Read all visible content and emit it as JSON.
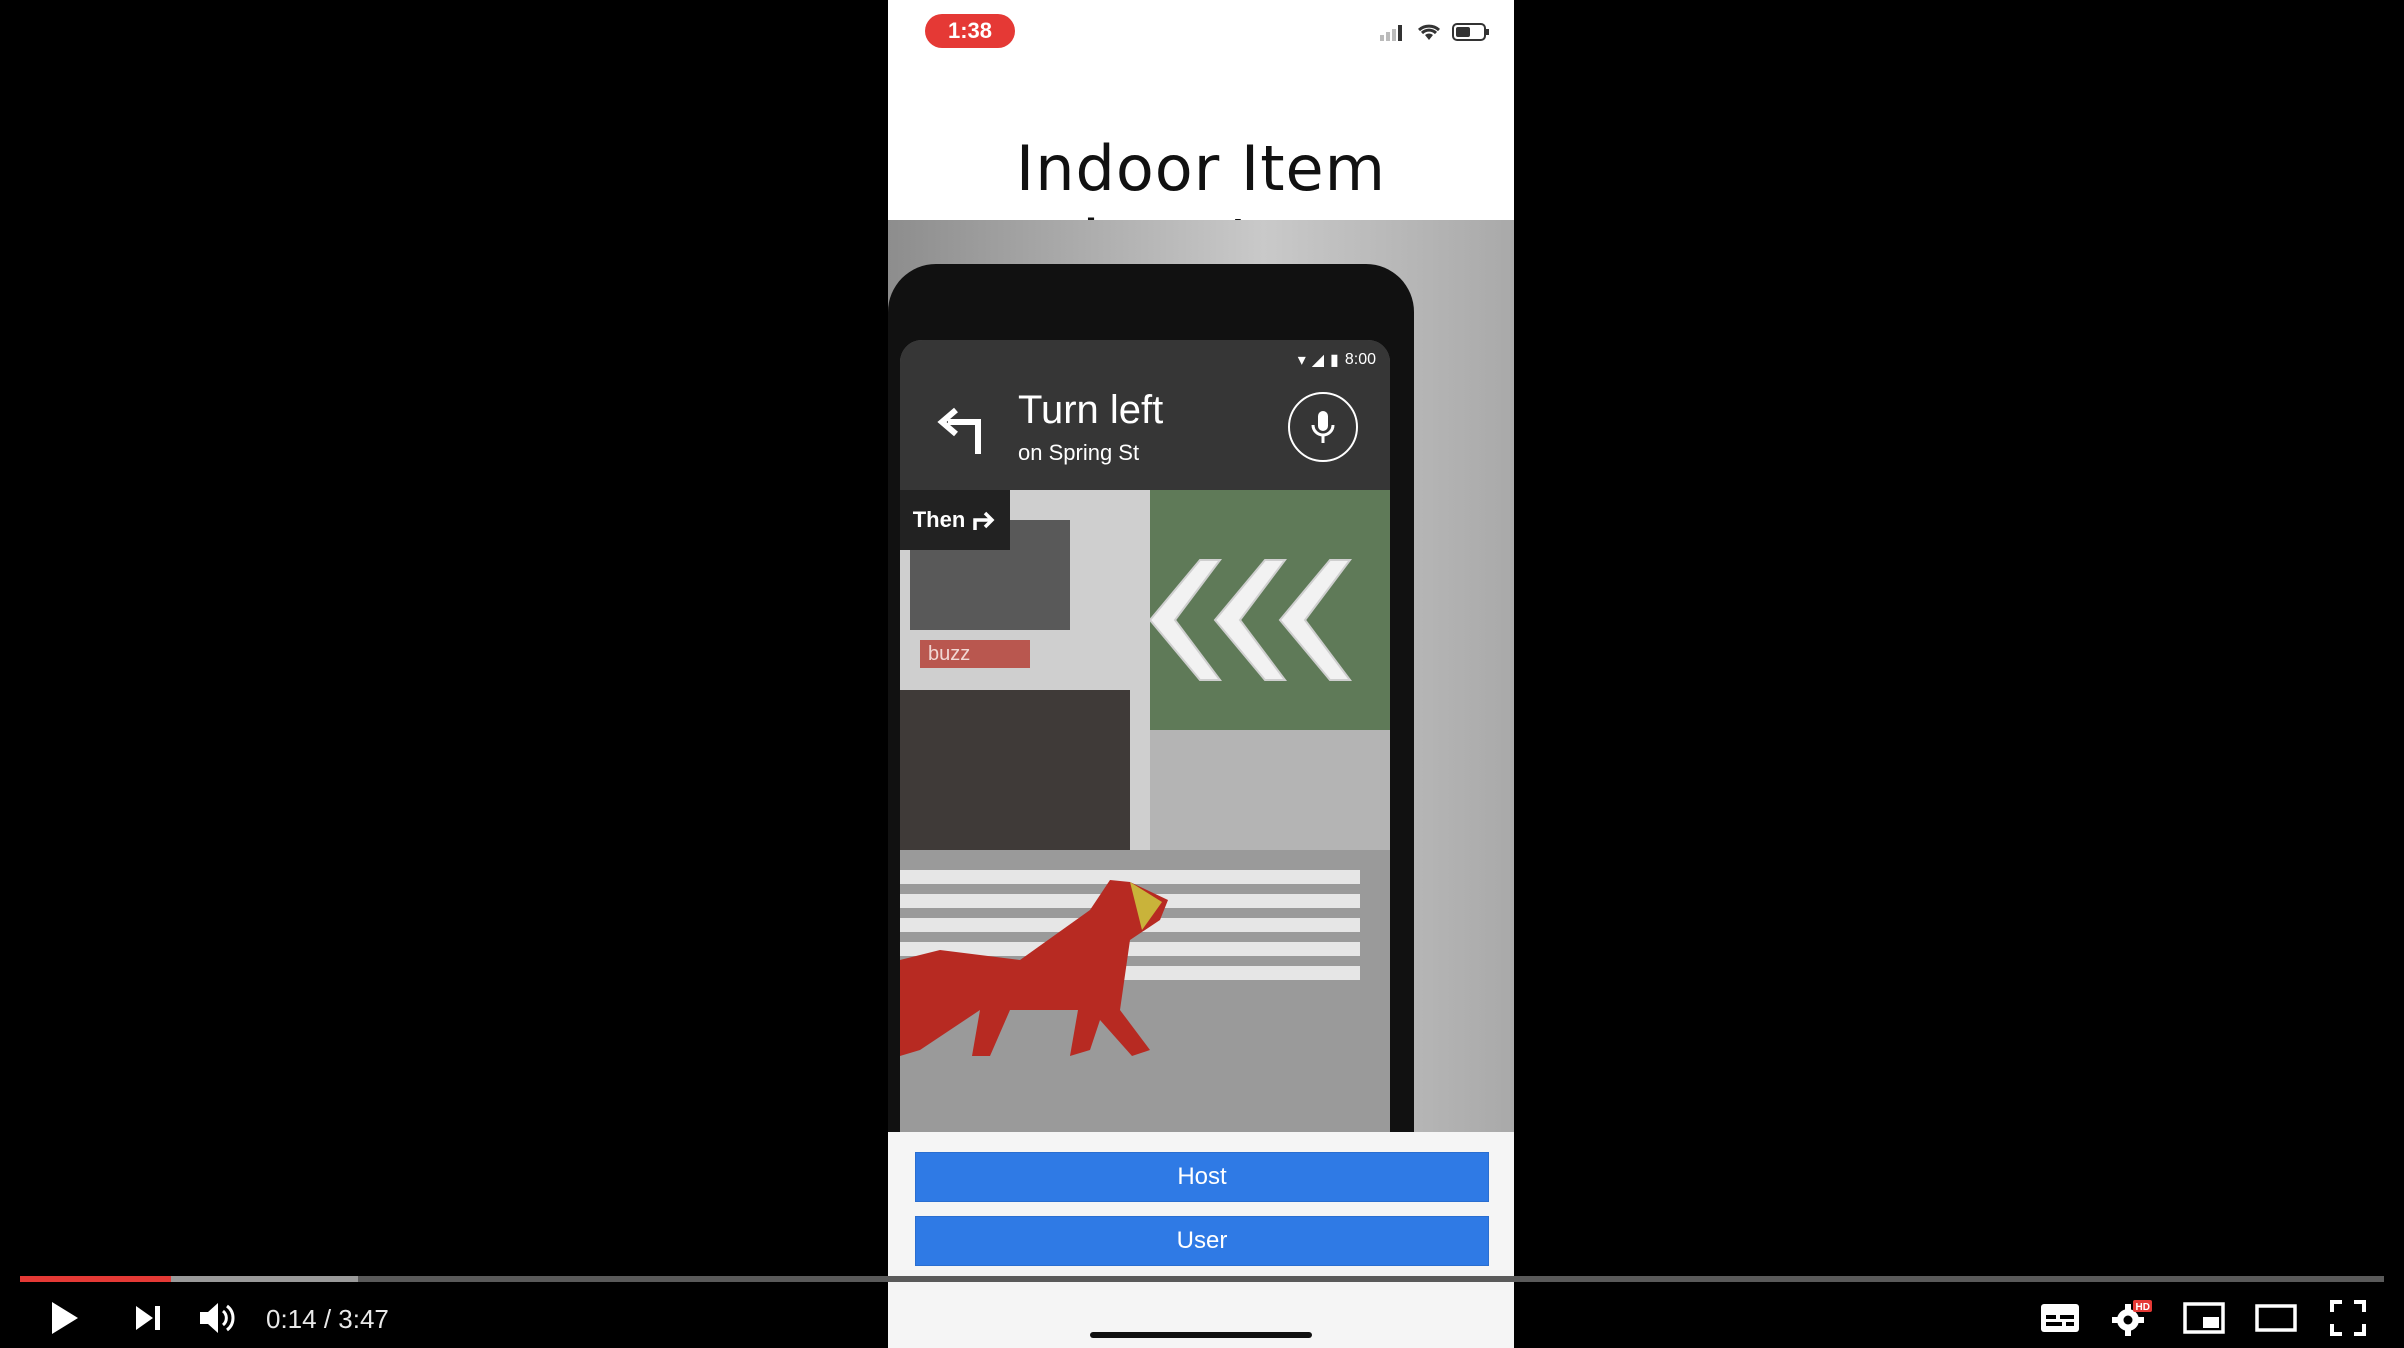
{
  "status_bar": {
    "time": "1:38"
  },
  "app": {
    "title": "Indoor Item Locator"
  },
  "video": {
    "nav_status_time": "8:00",
    "turn_title": "Turn left",
    "turn_subtitle": "on Spring St",
    "then_label": "Then",
    "store_sign": "buzz"
  },
  "buttons": {
    "host": "Host",
    "user": "User"
  },
  "player": {
    "current_time": "0:14",
    "separator": " / ",
    "duration": "3:47",
    "progress_fraction": 0.064,
    "buffer_fraction": 0.143,
    "hd_badge": "HD",
    "accent_color": "#e53935",
    "button_color": "#2f7ae5"
  },
  "icons": {
    "play": "play-icon",
    "next": "next-icon",
    "volume": "volume-icon",
    "captions": "captions-icon",
    "settings": "gear-icon",
    "miniplayer": "miniplayer-icon",
    "theater": "theater-icon",
    "fullscreen": "fullscreen-icon",
    "mic": "mic-icon",
    "turn_left": "turn-left-arrow-icon",
    "turn_right": "turn-right-arrow-icon"
  }
}
